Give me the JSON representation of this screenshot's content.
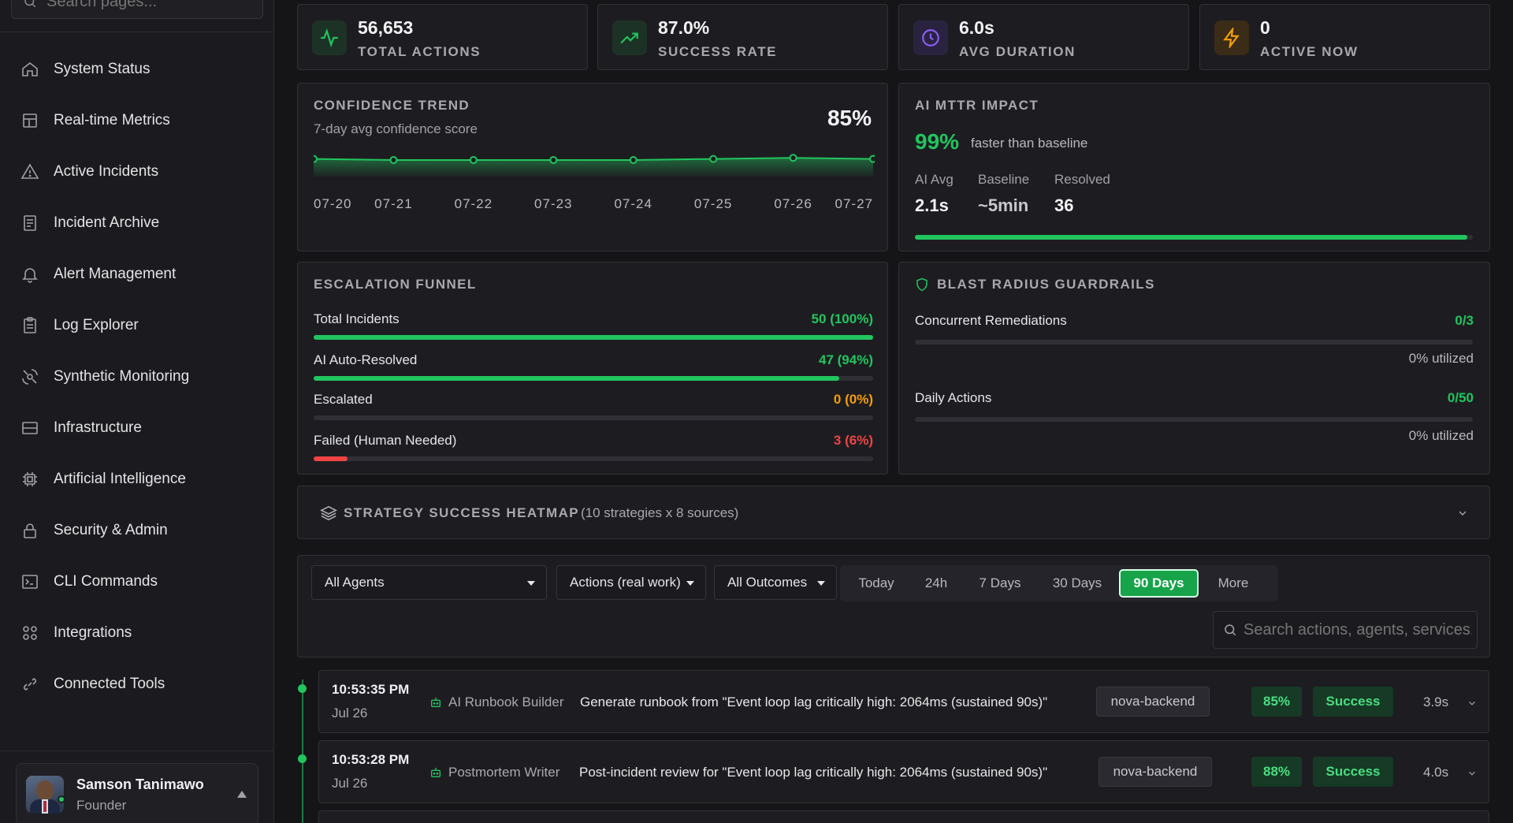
{
  "sidebar": {
    "search_placeholder": "Search pages...",
    "items": [
      {
        "label": "System Status",
        "icon": "home-icon"
      },
      {
        "label": "Real-time Metrics",
        "icon": "layout-icon"
      },
      {
        "label": "Active Incidents",
        "icon": "alert-triangle-icon"
      },
      {
        "label": "Incident Archive",
        "icon": "archive-icon"
      },
      {
        "label": "Alert Management",
        "icon": "bell-icon"
      },
      {
        "label": "Log Explorer",
        "icon": "clipboard-icon"
      },
      {
        "label": "Synthetic Monitoring",
        "icon": "satellite-icon"
      },
      {
        "label": "Infrastructure",
        "icon": "server-icon"
      },
      {
        "label": "Artificial Intelligence",
        "icon": "cpu-icon"
      },
      {
        "label": "Security & Admin",
        "icon": "lock-icon"
      },
      {
        "label": "CLI Commands",
        "icon": "terminal-icon"
      },
      {
        "label": "Integrations",
        "icon": "grid-icon"
      },
      {
        "label": "Connected Tools",
        "icon": "link-icon"
      }
    ],
    "user": {
      "name": "Samson Tanimawo",
      "role": "Founder"
    }
  },
  "stats": [
    {
      "value": "56,653",
      "label": "TOTAL ACTIONS",
      "icon": "activity-icon",
      "color": "#22c55e"
    },
    {
      "value": "87.0%",
      "label": "SUCCESS RATE",
      "icon": "trending-up-icon",
      "color": "#22c55e"
    },
    {
      "value": "6.0s",
      "label": "AVG DURATION",
      "icon": "clock-icon",
      "color": "#8b5cf6"
    },
    {
      "value": "0",
      "label": "ACTIVE NOW",
      "icon": "lightning-icon",
      "color": "#f59e0b"
    }
  ],
  "confidence": {
    "title": "CONFIDENCE TREND",
    "subtitle": "7-day avg confidence score",
    "value": "85%"
  },
  "chart_data": {
    "type": "area",
    "title": "CONFIDENCE TREND",
    "x": [
      "07-20",
      "07-21",
      "07-22",
      "07-23",
      "07-24",
      "07-25",
      "07-26",
      "07-27"
    ],
    "values": [
      85,
      84,
      84,
      84,
      84,
      85,
      86,
      85
    ],
    "ylim": [
      0,
      100
    ],
    "color": "#22c55e"
  },
  "mttr": {
    "title": "AI MTTR IMPACT",
    "headline": "99%",
    "headline_text": "faster than baseline",
    "cols": [
      {
        "label": "AI Avg",
        "value": "2.1s"
      },
      {
        "label": "Baseline",
        "value": "~5min"
      },
      {
        "label": "Resolved",
        "value": "36"
      }
    ],
    "progress": 0.99
  },
  "funnel": {
    "title": "ESCALATION FUNNEL",
    "rows": [
      {
        "label": "Total Incidents",
        "value": "50 (100%)",
        "fraction": 1.0,
        "color": "#22c55e"
      },
      {
        "label": "AI Auto-Resolved",
        "value": "47 (94%)",
        "fraction": 0.94,
        "color": "#22c55e"
      },
      {
        "label": "Escalated",
        "value": "0 (0%)",
        "fraction": 0.0,
        "color": "#f59e0b"
      },
      {
        "label": "Failed (Human Needed)",
        "value": "3 (6%)",
        "fraction": 0.06,
        "color": "#ef4444"
      }
    ]
  },
  "guardrails": {
    "title": "BLAST RADIUS GUARDRAILS",
    "rows": [
      {
        "label": "Concurrent Remediations",
        "value": "0/3",
        "util": "0% utilized",
        "fraction": 0.0
      },
      {
        "label": "Daily Actions",
        "value": "0/50",
        "util": "0% utilized",
        "fraction": 0.0
      }
    ]
  },
  "heatmap": {
    "title": "STRATEGY SUCCESS HEATMAP",
    "meta": "(10 strategies x 8 sources)"
  },
  "filters": {
    "agents": "All Agents",
    "actions": "Actions (real work)",
    "outcomes": "All Outcomes",
    "ranges": [
      "Today",
      "24h",
      "7 Days",
      "30 Days",
      "90 Days",
      "More"
    ],
    "active_range": "90 Days",
    "search_placeholder": "Search actions, agents, services..."
  },
  "activity": [
    {
      "time": "10:53:35 PM",
      "date": "Jul 26",
      "agent": "AI Runbook Builder",
      "desc": "Generate runbook from \"Event loop lag critically high: 2064ms (sustained 90s)\"",
      "service": "nova-backend",
      "confidence": "85%",
      "status": "Success",
      "duration": "3.9s"
    },
    {
      "time": "10:53:28 PM",
      "date": "Jul 26",
      "agent": "Postmortem Writer",
      "desc": "Post-incident review for \"Event loop lag critically high: 2064ms (sustained 90s)\"",
      "service": "nova-backend",
      "confidence": "88%",
      "status": "Success",
      "duration": "4.0s"
    }
  ]
}
